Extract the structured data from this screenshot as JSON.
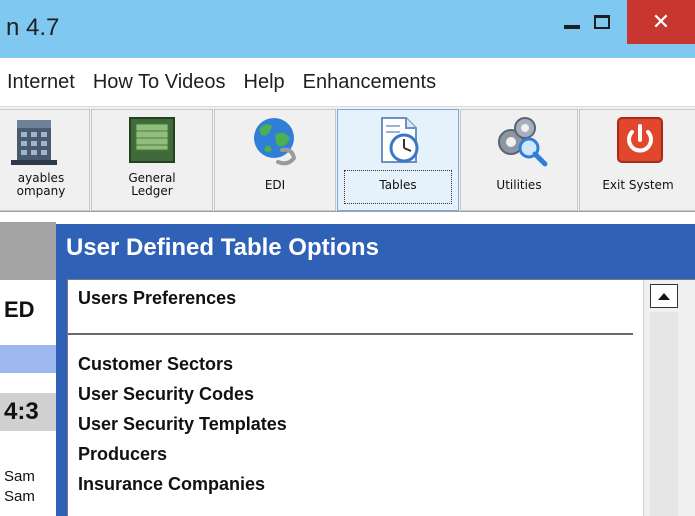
{
  "window": {
    "title": "n 4.7",
    "minimize_icon": "minimize-icon",
    "maximize_icon": "maximize-icon",
    "close_icon": "close-icon",
    "close_glyph": "✕"
  },
  "menu": {
    "items": [
      "Internet",
      "How To Videos",
      "Help",
      "Enhancements"
    ]
  },
  "toolbar": {
    "buttons": [
      {
        "line1": "ayables",
        "line2": "ompany",
        "icon": "building-icon"
      },
      {
        "line1": "General",
        "line2": "Ledger",
        "icon": "ledger-book-icon"
      },
      {
        "line1": "EDI",
        "line2": "",
        "icon": "globe-icon"
      },
      {
        "line1": "Tables",
        "line2": "",
        "icon": "clock-document-icon",
        "active": true
      },
      {
        "line1": "Utilities",
        "line2": "",
        "icon": "gears-magnifier-icon"
      },
      {
        "line1": "Exit System",
        "line2": "",
        "icon": "power-icon"
      }
    ]
  },
  "left_panel": {
    "heading": "ED",
    "time": "4:3",
    "rows": [
      "Sam",
      "Sam"
    ]
  },
  "dialog": {
    "title": "User Defined Table Options",
    "top_item": "Users Preferences",
    "items": [
      "Customer Sectors",
      "User Security Codes",
      "User Security Templates",
      "Producers",
      "Insurance Companies"
    ]
  },
  "colors": {
    "titlebar": "#7ec8f2",
    "close_button": "#c7372f",
    "dialog_blue": "#2f62b6",
    "selected_tool": "#e5f1fb"
  }
}
